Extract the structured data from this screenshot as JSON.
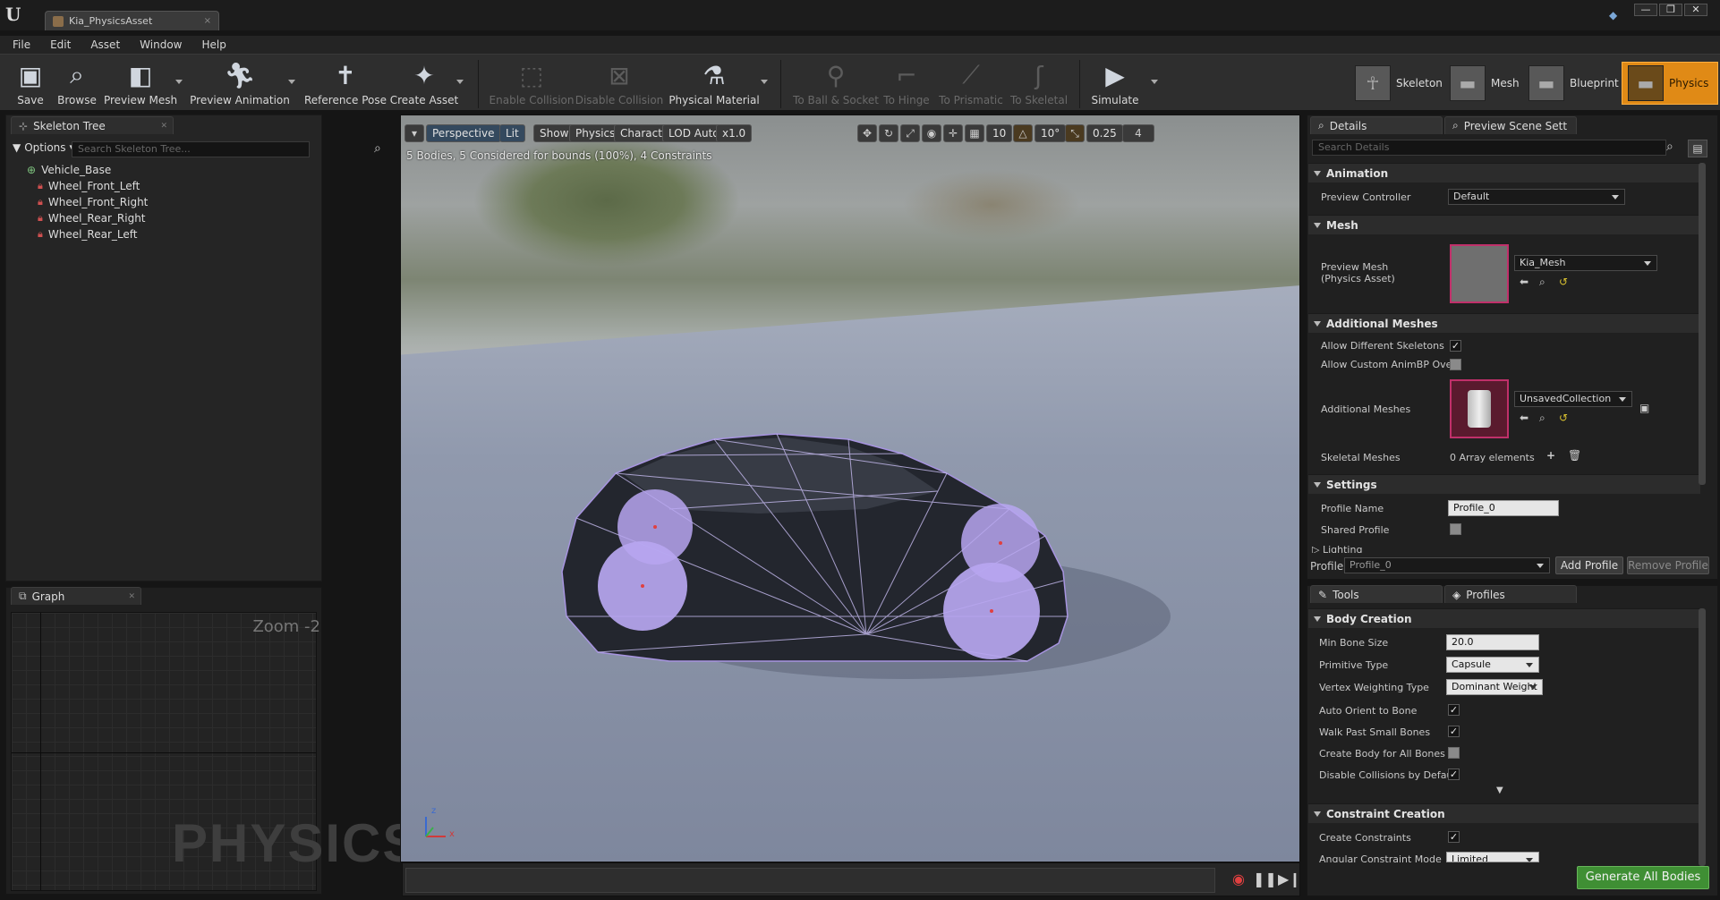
{
  "window": {
    "tab_title": "Kia_PhysicsAsset",
    "tab_close": "×",
    "buttons": [
      "—",
      "❐",
      "✕"
    ]
  },
  "menu": [
    "File",
    "Edit",
    "Asset",
    "Window",
    "Help"
  ],
  "toolbar": {
    "save": "Save",
    "browse": "Browse",
    "preview_mesh": "Preview Mesh",
    "preview_animation": "Preview Animation",
    "reference_pose": "Reference Pose",
    "create_asset": "Create Asset",
    "enable_collision": "Enable Collision",
    "disable_collision": "Disable Collision",
    "physical_material": "Physical Material",
    "to_ball_socket": "To Ball & Socket",
    "to_hinge": "To Hinge",
    "to_prismatic": "To Prismatic",
    "to_skeletal": "To Skeletal",
    "simulate": "Simulate"
  },
  "modes": {
    "skeleton": "Skeleton",
    "mesh": "Mesh",
    "blueprint": "Blueprint",
    "physics": "Physics"
  },
  "skeleton_tree": {
    "tab": "Skeleton Tree",
    "options": "Options",
    "search_placeholder": "Search Skeleton Tree...",
    "root": "Vehicle_Base",
    "bones": [
      "Wheel_Front_Left",
      "Wheel_Front_Right",
      "Wheel_Rear_Right",
      "Wheel_Rear_Left"
    ]
  },
  "graph": {
    "tab": "Graph",
    "zoom": "Zoom -2",
    "watermark": "PHYSICS"
  },
  "viewport": {
    "perspective": "Perspective",
    "lit": "Lit",
    "show": "Show",
    "physics": "Physics",
    "character": "Character",
    "lod": "LOD Auto",
    "speed": "x1.0",
    "grid_snap": "10",
    "rot_snap": "10°",
    "scale_snap": "0.25",
    "cam_speed": "4",
    "status": "5 Bodies, 5 Considered for bounds (100%), 4 Constraints",
    "axis_z": "z",
    "axis_x": "x"
  },
  "details": {
    "tab": "Details",
    "tab2": "Preview Scene Sett",
    "search_placeholder": "Search Details",
    "animation_cat": "Animation",
    "preview_controller_label": "Preview Controller",
    "preview_controller_value": "Default",
    "mesh_cat": "Mesh",
    "preview_mesh_label": "Preview Mesh",
    "preview_mesh_sub": "(Physics Asset)",
    "preview_mesh_value": "Kia_Mesh",
    "additional_meshes_cat": "Additional Meshes",
    "allow_diff_skel": "Allow Different Skeletons",
    "allow_custom_animbp": "Allow Custom AnimBP Ove",
    "additional_meshes_label": "Additional Meshes",
    "additional_meshes_value": "UnsavedCollection",
    "skeletal_meshes_label": "Skeletal Meshes",
    "skeletal_meshes_value": "0 Array elements",
    "settings_cat": "Settings",
    "profile_name_label": "Profile Name",
    "profile_name_value": "Profile_0",
    "shared_profile_label": "Shared Profile",
    "lighting_label": "Lighting",
    "profile_label": "Profile",
    "profile_value": "Profile_0",
    "add_profile": "Add Profile",
    "remove_profile": "Remove Profile"
  },
  "tools": {
    "tab": "Tools",
    "tab2": "Profiles",
    "body_creation_cat": "Body Creation",
    "min_bone_size_label": "Min Bone Size",
    "min_bone_size_value": "20.0",
    "primitive_type_label": "Primitive Type",
    "primitive_type_value": "Capsule",
    "vertex_weighting_label": "Vertex Weighting Type",
    "vertex_weighting_value": "Dominant Weight",
    "auto_orient_label": "Auto Orient to Bone",
    "walk_past_label": "Walk Past Small Bones",
    "create_body_all_label": "Create Body for All Bones",
    "disable_collisions_label": "Disable Collisions by Defau",
    "constraint_creation_cat": "Constraint Creation",
    "create_constraints_label": "Create Constraints",
    "angular_mode_label": "Angular Constraint Mode",
    "angular_mode_value": "Limited",
    "generate_all_bodies": "Generate All Bodies"
  },
  "colors": {
    "accent_orange": "#e08a16",
    "generate_green": "#3f8f34",
    "physics_body": "#a794e0"
  }
}
